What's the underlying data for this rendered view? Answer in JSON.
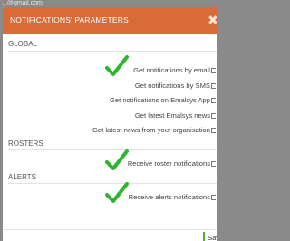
{
  "background": {
    "email_fragment": "...@gmail.com"
  },
  "modal": {
    "title": "NOTIFICATIONS' PARAMETERS",
    "close_symbol": "✖",
    "header_color": "#d96b38"
  },
  "sections": {
    "global": {
      "label": "GLOBAL",
      "options": [
        {
          "label": "Get notifications by email",
          "checked": true
        },
        {
          "label": "Get notifications by SMS",
          "checked": false
        },
        {
          "label": "Get notifications on Emalsys App",
          "checked": false
        },
        {
          "label": "Get latest Emalsys news",
          "checked": false
        },
        {
          "label": "Get latest news from your organisation",
          "checked": false
        }
      ]
    },
    "rosters": {
      "label": "ROSTERS",
      "options": [
        {
          "label": "Receive roster notifications",
          "checked": true
        }
      ]
    },
    "alerts": {
      "label": "ALERTS",
      "options": [
        {
          "label": "Receive alerts notifications",
          "checked": true
        }
      ]
    }
  },
  "footer": {
    "save_label": "Save"
  },
  "colors": {
    "check": "#2db52d",
    "save_accent": "#5aa83c"
  }
}
